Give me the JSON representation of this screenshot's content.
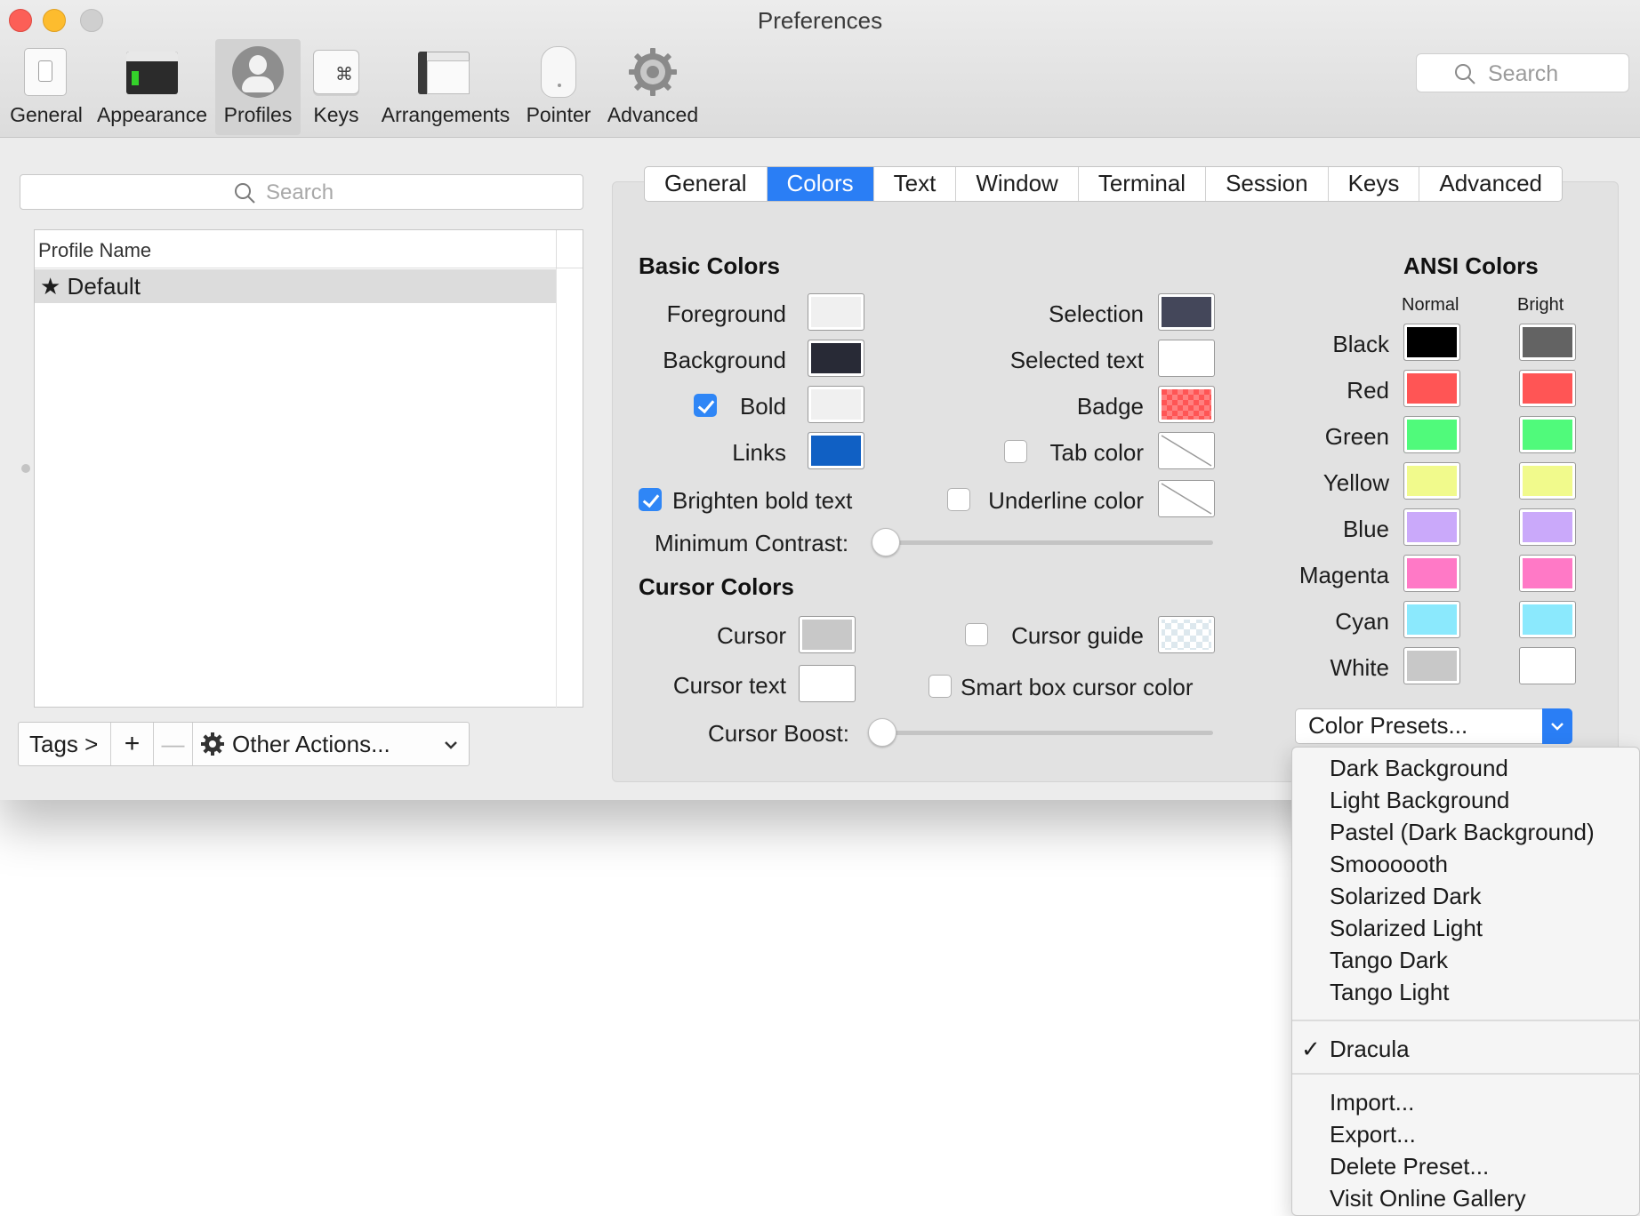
{
  "window": {
    "title": "Preferences"
  },
  "toolbar": {
    "items": [
      {
        "label": "General"
      },
      {
        "label": "Appearance"
      },
      {
        "label": "Profiles",
        "selected": true
      },
      {
        "label": "Keys"
      },
      {
        "label": "Arrangements"
      },
      {
        "label": "Pointer"
      },
      {
        "label": "Advanced"
      }
    ],
    "search_placeholder": "Search"
  },
  "profiles": {
    "search_placeholder": "Search",
    "column_header": "Profile Name",
    "rows": [
      {
        "star": "★",
        "name": "Default"
      }
    ],
    "bottom_bar": {
      "tags_label": "Tags >",
      "add_label": "+",
      "remove_label": "—",
      "other_actions_label": "Other Actions..."
    }
  },
  "tabs": [
    {
      "label": "General"
    },
    {
      "label": "Colors",
      "active": true
    },
    {
      "label": "Text"
    },
    {
      "label": "Window"
    },
    {
      "label": "Terminal"
    },
    {
      "label": "Session"
    },
    {
      "label": "Keys"
    },
    {
      "label": "Advanced"
    }
  ],
  "basic_colors": {
    "title": "Basic Colors",
    "foreground": {
      "label": "Foreground",
      "color": "#f0f0f0"
    },
    "background": {
      "label": "Background",
      "color": "#282a36"
    },
    "bold": {
      "label": "Bold",
      "checked": true,
      "color": "#f0f0f0"
    },
    "links": {
      "label": "Links",
      "color": "#1060c4"
    },
    "selection": {
      "label": "Selection",
      "color": "#44475a"
    },
    "selected_text": {
      "label": "Selected text",
      "color": "#ffffff"
    },
    "badge": {
      "label": "Badge",
      "color": "#ff5555"
    },
    "tab_color": {
      "label": "Tab color",
      "checked": false
    },
    "brighten_bold": {
      "label": "Brighten bold text",
      "checked": true
    },
    "underline_color": {
      "label": "Underline color",
      "checked": false
    },
    "minimum_contrast": {
      "label": "Minimum Contrast:",
      "value": 0
    }
  },
  "cursor_colors": {
    "title": "Cursor Colors",
    "cursor": {
      "label": "Cursor",
      "color": "#c8c8c8"
    },
    "cursor_text": {
      "label": "Cursor text",
      "color": "#ffffff"
    },
    "cursor_guide": {
      "label": "Cursor guide",
      "checked": false
    },
    "smart_box": {
      "label": "Smart box cursor color",
      "checked": false
    },
    "cursor_boost": {
      "label": "Cursor Boost:",
      "value": 0
    }
  },
  "ansi": {
    "title": "ANSI Colors",
    "normal_label": "Normal",
    "bright_label": "Bright",
    "rows": [
      {
        "name": "Black",
        "normal": "#000000",
        "bright": "#636363"
      },
      {
        "name": "Red",
        "normal": "#ff5555",
        "bright": "#ff5555"
      },
      {
        "name": "Green",
        "normal": "#50fa7b",
        "bright": "#50fa7b"
      },
      {
        "name": "Yellow",
        "normal": "#f1fa8c",
        "bright": "#f1fa8c"
      },
      {
        "name": "Blue",
        "normal": "#caa9fa",
        "bright": "#caa9fa"
      },
      {
        "name": "Magenta",
        "normal": "#ff79c6",
        "bright": "#ff79c6"
      },
      {
        "name": "Cyan",
        "normal": "#8be9fd",
        "bright": "#8be9fd"
      },
      {
        "name": "White",
        "normal": "#c8c8c8",
        "bright": "#ffffff"
      }
    ]
  },
  "presets": {
    "button_label": "Color Presets...",
    "menu": {
      "builtin": [
        "Dark Background",
        "Light Background",
        "Pastel (Dark Background)",
        "Smoooooth",
        "Solarized Dark",
        "Solarized Light",
        "Tango Dark",
        "Tango Light"
      ],
      "custom": [
        {
          "label": "Dracula",
          "checked": true,
          "check": "✓"
        }
      ],
      "actions": [
        "Import...",
        "Export...",
        "Delete Preset...",
        "Visit Online Gallery"
      ]
    }
  }
}
